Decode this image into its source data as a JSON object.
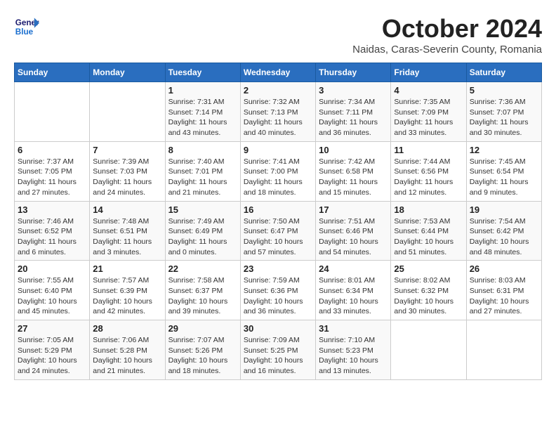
{
  "header": {
    "logo_line1": "General",
    "logo_line2": "Blue",
    "month": "October 2024",
    "location": "Naidas, Caras-Severin County, Romania"
  },
  "weekdays": [
    "Sunday",
    "Monday",
    "Tuesday",
    "Wednesday",
    "Thursday",
    "Friday",
    "Saturday"
  ],
  "weeks": [
    [
      {
        "day": "",
        "sunrise": "",
        "sunset": "",
        "daylight": ""
      },
      {
        "day": "",
        "sunrise": "",
        "sunset": "",
        "daylight": ""
      },
      {
        "day": "1",
        "sunrise": "Sunrise: 7:31 AM",
        "sunset": "Sunset: 7:14 PM",
        "daylight": "Daylight: 11 hours and 43 minutes."
      },
      {
        "day": "2",
        "sunrise": "Sunrise: 7:32 AM",
        "sunset": "Sunset: 7:13 PM",
        "daylight": "Daylight: 11 hours and 40 minutes."
      },
      {
        "day": "3",
        "sunrise": "Sunrise: 7:34 AM",
        "sunset": "Sunset: 7:11 PM",
        "daylight": "Daylight: 11 hours and 36 minutes."
      },
      {
        "day": "4",
        "sunrise": "Sunrise: 7:35 AM",
        "sunset": "Sunset: 7:09 PM",
        "daylight": "Daylight: 11 hours and 33 minutes."
      },
      {
        "day": "5",
        "sunrise": "Sunrise: 7:36 AM",
        "sunset": "Sunset: 7:07 PM",
        "daylight": "Daylight: 11 hours and 30 minutes."
      }
    ],
    [
      {
        "day": "6",
        "sunrise": "Sunrise: 7:37 AM",
        "sunset": "Sunset: 7:05 PM",
        "daylight": "Daylight: 11 hours and 27 minutes."
      },
      {
        "day": "7",
        "sunrise": "Sunrise: 7:39 AM",
        "sunset": "Sunset: 7:03 PM",
        "daylight": "Daylight: 11 hours and 24 minutes."
      },
      {
        "day": "8",
        "sunrise": "Sunrise: 7:40 AM",
        "sunset": "Sunset: 7:01 PM",
        "daylight": "Daylight: 11 hours and 21 minutes."
      },
      {
        "day": "9",
        "sunrise": "Sunrise: 7:41 AM",
        "sunset": "Sunset: 7:00 PM",
        "daylight": "Daylight: 11 hours and 18 minutes."
      },
      {
        "day": "10",
        "sunrise": "Sunrise: 7:42 AM",
        "sunset": "Sunset: 6:58 PM",
        "daylight": "Daylight: 11 hours and 15 minutes."
      },
      {
        "day": "11",
        "sunrise": "Sunrise: 7:44 AM",
        "sunset": "Sunset: 6:56 PM",
        "daylight": "Daylight: 11 hours and 12 minutes."
      },
      {
        "day": "12",
        "sunrise": "Sunrise: 7:45 AM",
        "sunset": "Sunset: 6:54 PM",
        "daylight": "Daylight: 11 hours and 9 minutes."
      }
    ],
    [
      {
        "day": "13",
        "sunrise": "Sunrise: 7:46 AM",
        "sunset": "Sunset: 6:52 PM",
        "daylight": "Daylight: 11 hours and 6 minutes."
      },
      {
        "day": "14",
        "sunrise": "Sunrise: 7:48 AM",
        "sunset": "Sunset: 6:51 PM",
        "daylight": "Daylight: 11 hours and 3 minutes."
      },
      {
        "day": "15",
        "sunrise": "Sunrise: 7:49 AM",
        "sunset": "Sunset: 6:49 PM",
        "daylight": "Daylight: 11 hours and 0 minutes."
      },
      {
        "day": "16",
        "sunrise": "Sunrise: 7:50 AM",
        "sunset": "Sunset: 6:47 PM",
        "daylight": "Daylight: 10 hours and 57 minutes."
      },
      {
        "day": "17",
        "sunrise": "Sunrise: 7:51 AM",
        "sunset": "Sunset: 6:46 PM",
        "daylight": "Daylight: 10 hours and 54 minutes."
      },
      {
        "day": "18",
        "sunrise": "Sunrise: 7:53 AM",
        "sunset": "Sunset: 6:44 PM",
        "daylight": "Daylight: 10 hours and 51 minutes."
      },
      {
        "day": "19",
        "sunrise": "Sunrise: 7:54 AM",
        "sunset": "Sunset: 6:42 PM",
        "daylight": "Daylight: 10 hours and 48 minutes."
      }
    ],
    [
      {
        "day": "20",
        "sunrise": "Sunrise: 7:55 AM",
        "sunset": "Sunset: 6:40 PM",
        "daylight": "Daylight: 10 hours and 45 minutes."
      },
      {
        "day": "21",
        "sunrise": "Sunrise: 7:57 AM",
        "sunset": "Sunset: 6:39 PM",
        "daylight": "Daylight: 10 hours and 42 minutes."
      },
      {
        "day": "22",
        "sunrise": "Sunrise: 7:58 AM",
        "sunset": "Sunset: 6:37 PM",
        "daylight": "Daylight: 10 hours and 39 minutes."
      },
      {
        "day": "23",
        "sunrise": "Sunrise: 7:59 AM",
        "sunset": "Sunset: 6:36 PM",
        "daylight": "Daylight: 10 hours and 36 minutes."
      },
      {
        "day": "24",
        "sunrise": "Sunrise: 8:01 AM",
        "sunset": "Sunset: 6:34 PM",
        "daylight": "Daylight: 10 hours and 33 minutes."
      },
      {
        "day": "25",
        "sunrise": "Sunrise: 8:02 AM",
        "sunset": "Sunset: 6:32 PM",
        "daylight": "Daylight: 10 hours and 30 minutes."
      },
      {
        "day": "26",
        "sunrise": "Sunrise: 8:03 AM",
        "sunset": "Sunset: 6:31 PM",
        "daylight": "Daylight: 10 hours and 27 minutes."
      }
    ],
    [
      {
        "day": "27",
        "sunrise": "Sunrise: 7:05 AM",
        "sunset": "Sunset: 5:29 PM",
        "daylight": "Daylight: 10 hours and 24 minutes."
      },
      {
        "day": "28",
        "sunrise": "Sunrise: 7:06 AM",
        "sunset": "Sunset: 5:28 PM",
        "daylight": "Daylight: 10 hours and 21 minutes."
      },
      {
        "day": "29",
        "sunrise": "Sunrise: 7:07 AM",
        "sunset": "Sunset: 5:26 PM",
        "daylight": "Daylight: 10 hours and 18 minutes."
      },
      {
        "day": "30",
        "sunrise": "Sunrise: 7:09 AM",
        "sunset": "Sunset: 5:25 PM",
        "daylight": "Daylight: 10 hours and 16 minutes."
      },
      {
        "day": "31",
        "sunrise": "Sunrise: 7:10 AM",
        "sunset": "Sunset: 5:23 PM",
        "daylight": "Daylight: 10 hours and 13 minutes."
      },
      {
        "day": "",
        "sunrise": "",
        "sunset": "",
        "daylight": ""
      },
      {
        "day": "",
        "sunrise": "",
        "sunset": "",
        "daylight": ""
      }
    ]
  ]
}
